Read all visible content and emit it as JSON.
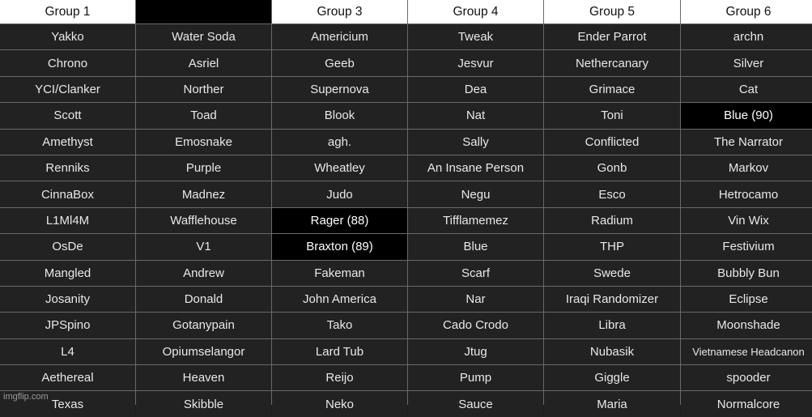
{
  "table": {
    "headers": [
      {
        "label": "Group 1",
        "highlight": false
      },
      {
        "label": "",
        "highlight": true
      },
      {
        "label": "Group 3",
        "highlight": false
      },
      {
        "label": "Group 4",
        "highlight": false
      },
      {
        "label": "Group 5",
        "highlight": false
      },
      {
        "label": "Group 6",
        "highlight": false
      }
    ],
    "rows": [
      [
        "Yakko",
        "Water Soda",
        "Americium",
        "Tweak",
        "Ender Parrot",
        "archn"
      ],
      [
        "Chrono",
        "Asriel",
        "Geeb",
        "Jesvur",
        "Nethercanary",
        "Silver"
      ],
      [
        "YCI/Clanker",
        "Norther",
        "Supernova",
        "Dea",
        "Grimace",
        "Cat"
      ],
      [
        "Scott",
        "Toad",
        "Blook",
        "Nat",
        "Toni",
        "Blue (90)"
      ],
      [
        "Amethyst",
        "Emosnake",
        "agh.",
        "Sally",
        "Conflicted",
        "The Narrator"
      ],
      [
        "Renniks",
        "Purple",
        "Wheatley",
        "An Insane Person",
        "Gonb",
        "Markov"
      ],
      [
        "CinnaBox",
        "Madnez",
        "Judo",
        "Negu",
        "Esco",
        "Hetrocamo"
      ],
      [
        "L1Ml4M",
        "Wafflehouse",
        "Rager (88)",
        "Tifflamemez",
        "Radium",
        "Vin Wix"
      ],
      [
        "OsDe",
        "V1",
        "Braxton (89)",
        "Blue",
        "THP",
        "Festivium"
      ],
      [
        "Mangled",
        "Andrew",
        "Fakeman",
        "Scarf",
        "Swede",
        "Bubbly Bun"
      ],
      [
        "Josanity",
        "Donald",
        "John America",
        "Nar",
        "Iraqi Randomizer",
        "Eclipse"
      ],
      [
        "JPSpino",
        "Gotanypain",
        "Tako",
        "Cado Crodo",
        "Libra",
        "Moonshade"
      ],
      [
        "L4",
        "Opiumselangor",
        "Lard Tub",
        "Jtug",
        "Nubasik",
        "Vietnamese Headcanon"
      ],
      [
        "Aethereal",
        "Heaven",
        "Reijo",
        "Pump",
        "Giggle",
        "spooder"
      ],
      [
        "Texas",
        "Skibble",
        "Neko",
        "Sauce",
        "Maria",
        "Normalcore"
      ]
    ],
    "highlighted_cells": [
      {
        "row": 3,
        "col": 5
      },
      {
        "row": 7,
        "col": 2
      },
      {
        "row": 8,
        "col": 2
      }
    ],
    "small_text_cells": [
      {
        "row": 12,
        "col": 5
      }
    ]
  },
  "colors": {
    "header_bg": "#ffffff",
    "cell_bg": "#222222",
    "highlight_bg": "#000000",
    "grid_line": "#6a6a6a",
    "text": "#e8e8e8"
  },
  "watermark": "imgflip.com"
}
